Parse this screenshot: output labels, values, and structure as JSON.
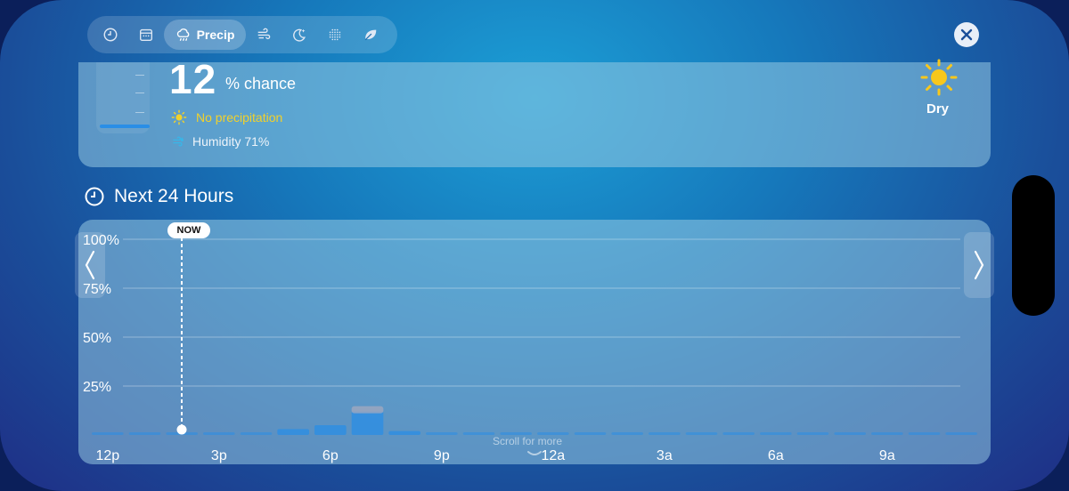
{
  "toolbar": {
    "items": [
      {
        "icon": "clock-icon"
      },
      {
        "icon": "calendar-icon"
      },
      {
        "icon": "rain-cloud-icon",
        "label": "Precip",
        "active": true
      },
      {
        "icon": "wind-icon"
      },
      {
        "icon": "moon-stars-icon"
      },
      {
        "icon": "snowflake-dots-icon"
      },
      {
        "icon": "leaf-icon"
      }
    ],
    "close_icon": "close-icon"
  },
  "summary": {
    "value": "12",
    "unit": "% chance",
    "status": "No precipitation",
    "humidity": "Humidity 71%",
    "condition_label": "Dry",
    "condition_icon": "sun-icon",
    "status_color": "#f2d12a"
  },
  "section": {
    "title": "Next 24 Hours",
    "icon": "clock-icon"
  },
  "chart": {
    "now_label": "NOW",
    "scroll_hint": "Scroll for more",
    "y_labels": [
      "100%",
      "75%",
      "50%",
      "25%"
    ],
    "x_labels": [
      "12p",
      "3p",
      "6p",
      "9p",
      "12a",
      "3a",
      "6a",
      "9a"
    ]
  },
  "chart_data": {
    "type": "bar",
    "title": "",
    "xlabel": "",
    "ylabel": "",
    "ylim": [
      0,
      100
    ],
    "categories": [
      "12p",
      "1p",
      "2p",
      "3p",
      "4p",
      "5p",
      "6p",
      "7p",
      "8p",
      "9p",
      "10p",
      "11p",
      "12a",
      "1a",
      "2a",
      "3a",
      "4a",
      "5a",
      "6a",
      "7a",
      "8a",
      "9a",
      "10a",
      "11a"
    ],
    "values": [
      0,
      0,
      0,
      0,
      0,
      3,
      5,
      12,
      2,
      0,
      0,
      0,
      0,
      0,
      0,
      0,
      0,
      0,
      0,
      0,
      0,
      0,
      0,
      0
    ],
    "now_index": 2.5,
    "now_value": 3,
    "accent_color": "#2a8ee6"
  }
}
